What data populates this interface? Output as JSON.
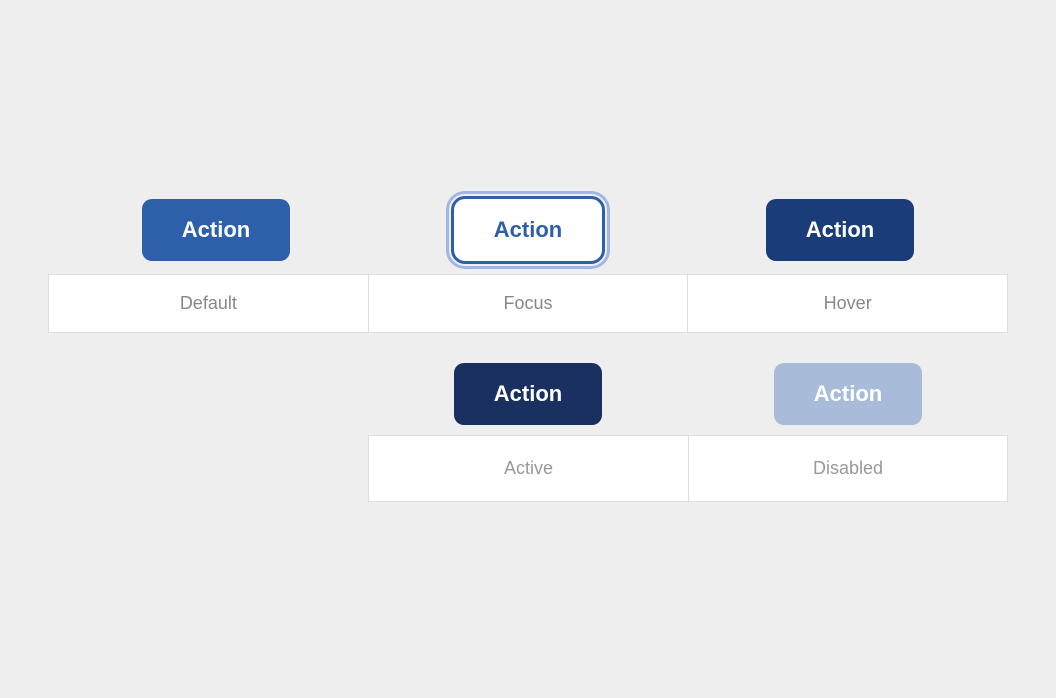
{
  "buttons": {
    "action_label": "Action",
    "active_label": "Active",
    "disabled_label": "Disabled"
  },
  "state_labels": {
    "default": "Default",
    "focus": "Focus",
    "hover": "Hover",
    "active": "Active",
    "disabled": "Disabled"
  }
}
